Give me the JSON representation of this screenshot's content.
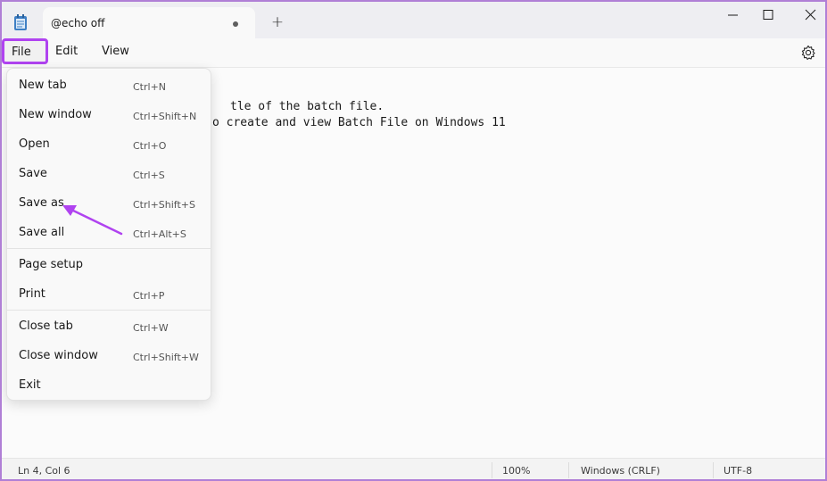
{
  "window": {
    "tab_title": "@echo off",
    "new_tab_glyph": "+"
  },
  "menubar": {
    "file": "File",
    "edit": "Edit",
    "view": "View"
  },
  "editor": {
    "lines": [
      "tle of the batch file.",
      "o create and view Batch File on Windows 11"
    ]
  },
  "file_menu": {
    "items": [
      {
        "label": "New tab",
        "shortcut": "Ctrl+N"
      },
      {
        "label": "New window",
        "shortcut": "Ctrl+Shift+N"
      },
      {
        "label": "Open",
        "shortcut": "Ctrl+O"
      },
      {
        "label": "Save",
        "shortcut": "Ctrl+S"
      },
      {
        "label": "Save as",
        "shortcut": "Ctrl+Shift+S"
      },
      {
        "label": "Save all",
        "shortcut": "Ctrl+Alt+S"
      },
      {
        "label": "Page setup",
        "shortcut": ""
      },
      {
        "label": "Print",
        "shortcut": "Ctrl+P"
      },
      {
        "label": "Close tab",
        "shortcut": "Ctrl+W"
      },
      {
        "label": "Close window",
        "shortcut": "Ctrl+Shift+W"
      },
      {
        "label": "Exit",
        "shortcut": ""
      }
    ]
  },
  "statusbar": {
    "position": "Ln 4, Col 6",
    "zoom": "100%",
    "line_ending": "Windows (CRLF)",
    "encoding": "UTF-8"
  },
  "colors": {
    "highlight": "#b043f0",
    "window_border": "#b07fd6"
  }
}
